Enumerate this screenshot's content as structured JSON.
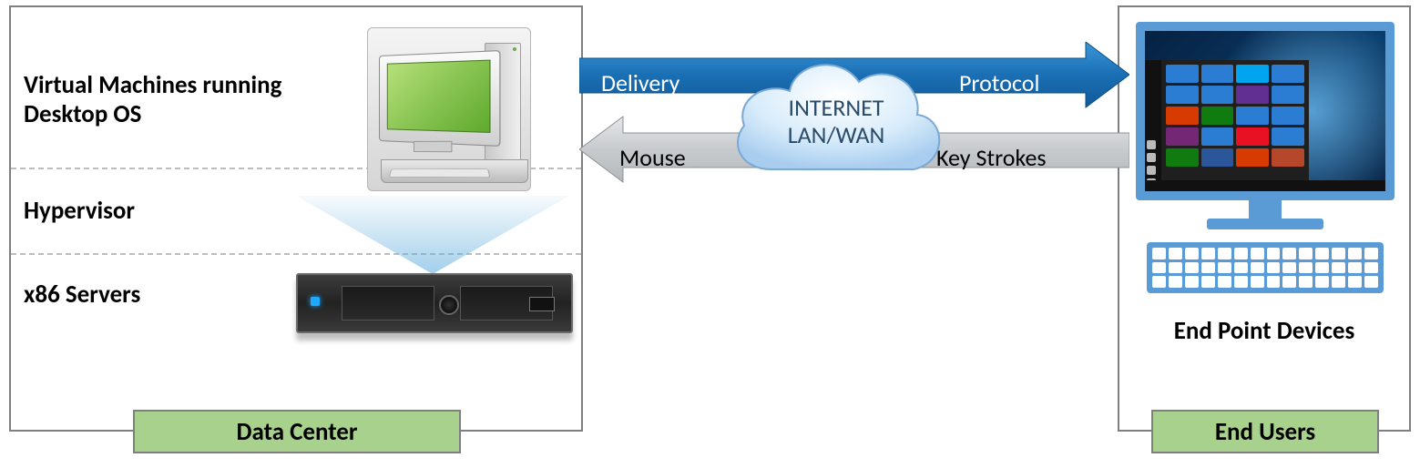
{
  "left_box": {
    "vm_label": "Virtual Machines running Desktop OS",
    "hypervisor_label": "Hypervisor",
    "servers_label": "x86 Servers",
    "caption": "Data Center"
  },
  "right_box": {
    "device_label": "End Point Devices",
    "caption": "End Users"
  },
  "arrows": {
    "top_left": "Delivery",
    "top_right": "Protocol",
    "bottom_left": "Mouse",
    "bottom_right": "Key Strokes"
  },
  "cloud": {
    "line1": "INTERNET",
    "line2": "LAN/WAN"
  },
  "colors": {
    "blue_arrow": "#1f78c1",
    "gray_arrow": "#cfd3d6",
    "green_box": "#a9d18e",
    "client_blue": "#5b9bd5"
  },
  "tiles": [
    "#2b7cd3",
    "#2b7cd3",
    "#00a4ef",
    "#2b7cd3",
    "#2b7cd3",
    "#2b7cd3",
    "#602f91",
    "#2b7cd3",
    "#d83b01",
    "#107c10",
    "#2b7cd3",
    "#2b7cd3",
    "#742774",
    "#2b7cd3",
    "#e81123",
    "#2b7cd3",
    "#107c10",
    "#2b579a",
    "#d83b01",
    "#b7472a"
  ]
}
